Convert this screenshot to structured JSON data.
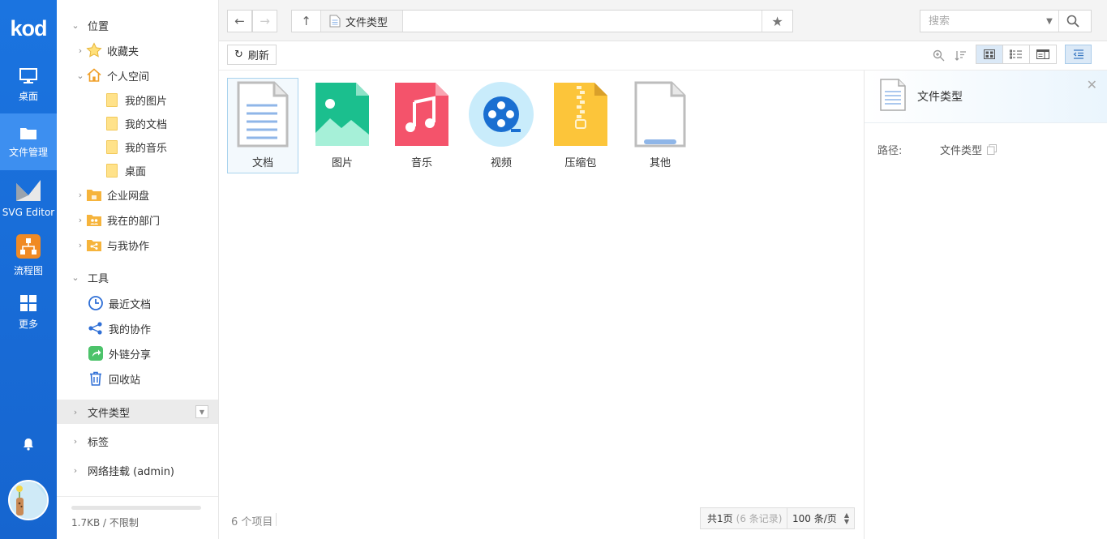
{
  "app": {
    "logo_text": "kod",
    "nav": [
      {
        "label": "桌面",
        "icon": "monitor-icon"
      },
      {
        "label": "文件管理",
        "icon": "folder-icon"
      },
      {
        "label": "SVG Editor",
        "icon": "svg-editor-icon"
      },
      {
        "label": "流程图",
        "icon": "flowchart-icon"
      },
      {
        "label": "更多",
        "icon": "grid-icon"
      }
    ]
  },
  "sidebar": {
    "location_header": "位置",
    "favorites": "收藏夹",
    "personal": "个人空间",
    "personal_children": [
      "我的图片",
      "我的文档",
      "我的音乐",
      "桌面"
    ],
    "enterprise": "企业网盘",
    "my_department": "我在的部门",
    "shared_with_me": "与我协作",
    "tools_header": "工具",
    "tools": [
      {
        "label": "最近文档",
        "icon": "clock-icon"
      },
      {
        "label": "我的协作",
        "icon": "share-nodes-icon"
      },
      {
        "label": "外链分享",
        "icon": "share-arrow-icon"
      },
      {
        "label": "回收站",
        "icon": "trash-icon"
      }
    ],
    "file_types": "文件类型",
    "tags": "标签",
    "network_mount": "网络挂载 (admin)",
    "quota": "1.7KB / 不限制"
  },
  "topbar": {
    "breadcrumb": "文件类型",
    "search_placeholder": "搜索"
  },
  "toolbar": {
    "refresh_label": "刷新"
  },
  "files": [
    {
      "name": "文档",
      "icon": "document-icon"
    },
    {
      "name": "图片",
      "icon": "image-icon"
    },
    {
      "name": "音乐",
      "icon": "music-icon"
    },
    {
      "name": "视频",
      "icon": "video-icon"
    },
    {
      "name": "压缩包",
      "icon": "zip-icon"
    },
    {
      "name": "其他",
      "icon": "other-file-icon"
    }
  ],
  "status": {
    "item_count": "6 个项目",
    "pages": "共1页",
    "records": "(6 条记录)",
    "page_size": "100 条/页"
  },
  "info_panel": {
    "title": "文件类型",
    "path_label": "路径:",
    "path_value": "文件类型"
  },
  "colors": {
    "accent": "#1b74e0",
    "rail_active": "#3d8ff0",
    "selection": "#a9d3ee"
  }
}
